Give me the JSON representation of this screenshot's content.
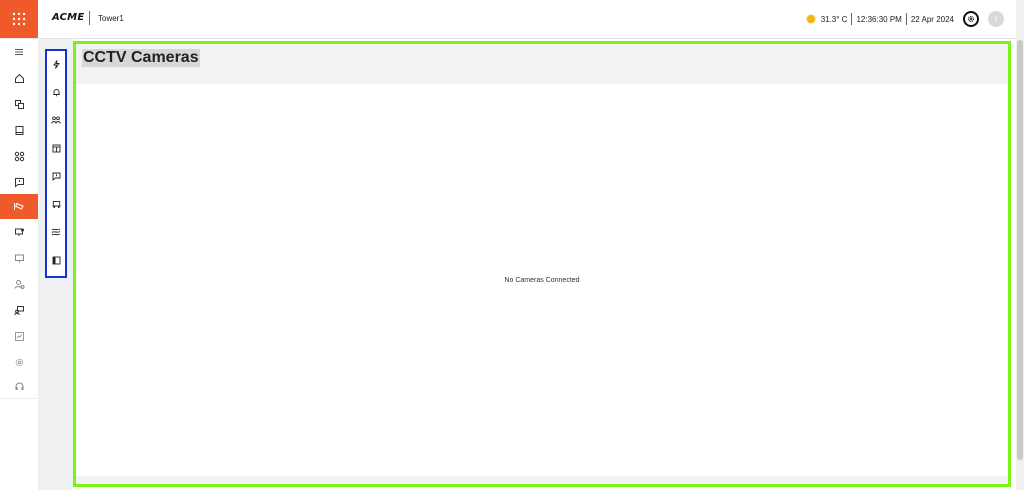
{
  "header": {
    "logo_text": "ACME",
    "tenant": "Tower1",
    "temperature": "31.3° C",
    "time": "12:36:30 PM",
    "date": "22 Apr 2024",
    "avatar_initial": "I"
  },
  "colors": {
    "accent": "#ef5a2a",
    "subnav_border": "#1a2fd6",
    "main_border": "#7cf21b"
  },
  "sidebar": {
    "items": [
      {
        "icon": "menu-icon"
      },
      {
        "icon": "home-icon"
      },
      {
        "icon": "layers-icon"
      },
      {
        "icon": "book-icon"
      },
      {
        "icon": "apps-icon"
      },
      {
        "icon": "message-alert-icon"
      },
      {
        "icon": "cctv-icon",
        "active": true
      },
      {
        "icon": "monitor-icon"
      },
      {
        "icon": "presentation-icon"
      },
      {
        "icon": "users-icon"
      },
      {
        "icon": "user-screen-icon"
      },
      {
        "icon": "report-icon"
      },
      {
        "icon": "settings-icon"
      },
      {
        "icon": "support-icon"
      }
    ]
  },
  "subnav": {
    "items": [
      {
        "icon": "lightning-icon"
      },
      {
        "icon": "bell-icon"
      },
      {
        "icon": "people-icon"
      },
      {
        "icon": "elevator-icon"
      },
      {
        "icon": "chat-icon"
      },
      {
        "icon": "car-icon"
      },
      {
        "icon": "fan-icon"
      },
      {
        "icon": "panel-icon"
      }
    ]
  },
  "main": {
    "title": "CCTV Cameras",
    "empty_message": "No Cameras Connected"
  }
}
